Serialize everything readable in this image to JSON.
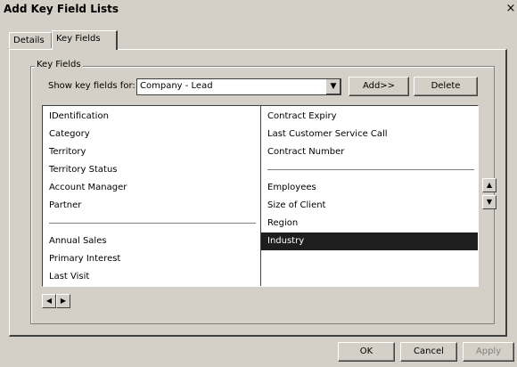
{
  "window": {
    "title": "Add Key Field Lists",
    "close_glyph": "×"
  },
  "tabs": [
    {
      "label": "Details"
    },
    {
      "label": "Key Fields"
    }
  ],
  "group": {
    "label": "Key Fields"
  },
  "show_for": {
    "label": "Show key fields for:",
    "value": "Company - Lead"
  },
  "buttons": {
    "add": "Add>>",
    "delete": "Delete",
    "ok": "OK",
    "cancel": "Cancel",
    "apply": "Apply"
  },
  "left_column": {
    "items": [
      "IDentification",
      "Category",
      "Territory",
      "Territory Status",
      "Account Manager",
      "Partner"
    ],
    "items2": [
      "Annual Sales",
      "Primary Interest",
      "Last Visit"
    ]
  },
  "right_column": {
    "items": [
      "Contract Expiry",
      "Last Customer Service Call",
      "Contract Number"
    ],
    "items2": [
      "Employees",
      "Size of Client",
      "Region",
      "Industry"
    ],
    "selected": "Industry"
  },
  "icons": {
    "dropdown": "▼",
    "scroll_left": "◀",
    "scroll_right": "▶",
    "move_up": "▲",
    "move_down": "▼"
  }
}
